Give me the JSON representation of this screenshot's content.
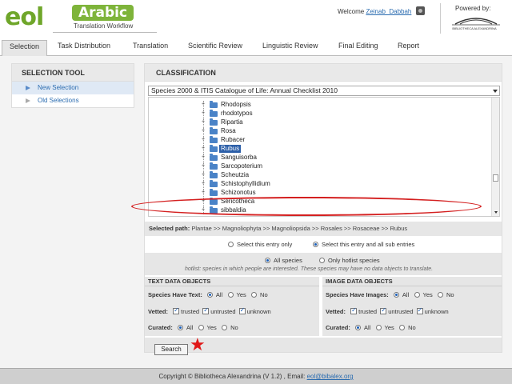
{
  "header": {
    "logo_text": "eol",
    "logo_badge": "Arabic",
    "logo_subtitle": "Translation Workflow",
    "welcome_label": "Welcome",
    "username": "Zeinab_Dabbah",
    "powered_by": "Powered by:",
    "bibalex_logo_text": "BIBLIOTHECA ALEXANDRINA"
  },
  "tabs": [
    {
      "label": "Selection",
      "active": true
    },
    {
      "label": "Task Distribution"
    },
    {
      "label": "Translation"
    },
    {
      "label": "Scientific Review"
    },
    {
      "label": "Linguistic Review"
    },
    {
      "label": "Final Editing"
    },
    {
      "label": "Report"
    }
  ],
  "selection_tool": {
    "title": "SELECTION TOOL",
    "items": [
      {
        "label": "New Selection",
        "active": true
      },
      {
        "label": "Old Selections"
      }
    ]
  },
  "classification": {
    "title": "CLASSIFICATION",
    "source": "Species 2000 & ITIS Catalogue of Life: Annual Checklist 2010",
    "tree": [
      "Rhodopsis",
      "rhodotypos",
      "Ripartia",
      "Rosa",
      "Rubacer",
      "Rubus",
      "Sanguisorba",
      "Sarcopoterium",
      "Scheutzia",
      "Schistophyllidium",
      "Schizonotus",
      "Sericotheca",
      "sibbaldia"
    ],
    "selected_node": "Rubus",
    "selected_path_label": "Selected path:",
    "selected_path": "Plantae >> Magnoliophyta >> Magnoliopsida >> Rosales >> Rosaceae >> Rubus"
  },
  "entry_options": {
    "this_only": "Select this entry only",
    "all_sub": "Select this entry and all sub entries",
    "selected": "all_sub"
  },
  "species_filter": {
    "all": "All species",
    "hotlist": "Only hotlist species",
    "selected": "all",
    "note": "hotlist: species in which people are interested. These species may have no data objects to translate."
  },
  "text_objects": {
    "title": "TEXT DATA OBJECTS",
    "have_label": "Species Have Text:",
    "have_options": [
      "All",
      "Yes",
      "No"
    ],
    "vetted_label": "Vetted:",
    "vetted_options": [
      "trusted",
      "untrusted",
      "unknown"
    ],
    "curated_label": "Curated:",
    "curated_options": [
      "All",
      "Yes",
      "No"
    ]
  },
  "image_objects": {
    "title": "IMAGE DATA OBJECTS",
    "have_label": "Species Have Images:",
    "have_options": [
      "All",
      "Yes",
      "No"
    ],
    "vetted_label": "Vetted:",
    "vetted_options": [
      "trusted",
      "untrusted",
      "unknown"
    ],
    "curated_label": "Curated:",
    "curated_options": [
      "All",
      "Yes",
      "No"
    ]
  },
  "search_label": "Search",
  "footer": {
    "copyright": "Copyright © Bibliotheca Alexandrina (V 1.2) , Email:",
    "email": "eol@bibalex.org"
  },
  "colors": {
    "logo_green": "#6fa62a",
    "link_blue": "#2b6cb0",
    "selection_blue": "#2c5fa8",
    "annotation_red": "#d42020"
  }
}
